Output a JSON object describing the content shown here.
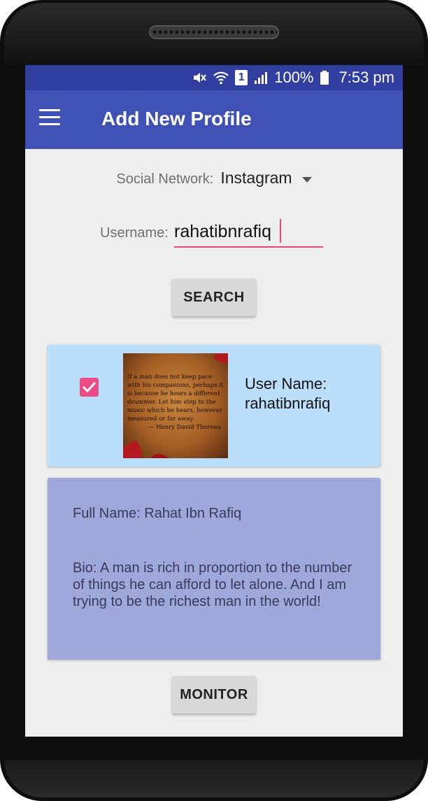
{
  "status_bar": {
    "battery_percent": "100%",
    "time": "7:53 pm",
    "sim_badge": "1",
    "icons": [
      "mute-icon",
      "wifi-icon",
      "sim-icon",
      "signal-icon",
      "battery-icon"
    ]
  },
  "app_bar": {
    "title": "Add New Profile",
    "menu_icon": "hamburger-menu-icon"
  },
  "form": {
    "network_label": "Social Network:",
    "network_value": "Instagram",
    "username_label": "Username:",
    "username_value": "rahatibnrafiq"
  },
  "buttons": {
    "search": "SEARCH",
    "monitor": "MONITOR"
  },
  "result": {
    "checked": true,
    "username_label": "User Name:",
    "username_value": "rahatibnrafiq",
    "image_quote": "If a man does not keep pace with his companions, perhaps it is because he hears a different drummer. Let him step to the music which he hears, however measured or far away.",
    "image_attribution": "— Henry David Thoreau"
  },
  "details": {
    "full_name": "Full Name: Rahat Ibn Rafiq",
    "bio": "Bio: A man is rich in proportion to the number of things he can afford to let alone. And I am trying to be the richest man in the world!"
  },
  "colors": {
    "status_bar": "#303f9f",
    "app_bar": "#3f51b5",
    "accent": "#e8457d",
    "result_card": "#bbdefb",
    "detail_card": "#9fa8da"
  }
}
